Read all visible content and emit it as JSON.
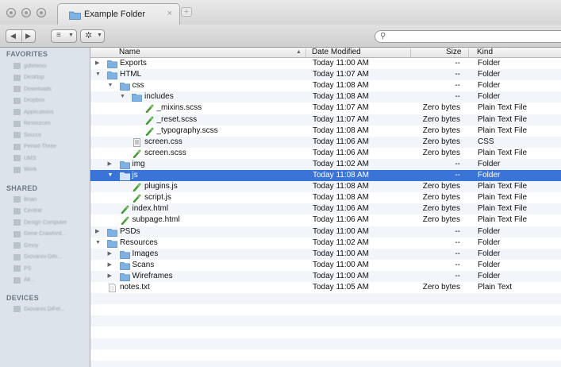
{
  "window": {
    "tab_title": "Example Folder",
    "tab_close": "×",
    "new_tab": "+",
    "search_placeholder": ""
  },
  "toolbar": {
    "back_icon": "back-arrow-icon",
    "forward_icon": "forward-arrow-icon",
    "view_icon": "list-view-icon",
    "action_icon": "gear-icon"
  },
  "sidebar": {
    "favorites_header": "FAVORITES",
    "favorites": [
      "gdfeterici",
      "Desktop",
      "Downloads",
      "Dropbox",
      "Applications",
      "Resources",
      "Source",
      "Period-Three",
      "UMS",
      "Work"
    ],
    "shared_header": "SHARED",
    "shared": [
      "Brian",
      "Central",
      "Design Computer",
      "Gene Crawford...",
      "Ginny",
      "Giovanni-Difo...",
      "PS",
      "All..."
    ],
    "devices_header": "DEVICES",
    "devices": [
      "Giovanni DiFel..."
    ]
  },
  "columns": {
    "name": "Name",
    "date": "Date Modified",
    "size": "Size",
    "kind": "Kind"
  },
  "colors": {
    "selection": "#3a74d6",
    "folder": "#7fb2e2",
    "sidebar": "#dde3ea",
    "scss_leaf": "#4a9d3a"
  },
  "rows": [
    {
      "name": "Exports",
      "date": "Today 11:00 AM",
      "size": "--",
      "kind": "Folder",
      "icon": "folder-icon",
      "indent": 0,
      "disclosure": "closed"
    },
    {
      "name": "HTML",
      "date": "Today 11:07 AM",
      "size": "--",
      "kind": "Folder",
      "icon": "folder-icon",
      "indent": 0,
      "disclosure": "open"
    },
    {
      "name": "css",
      "date": "Today 11:08 AM",
      "size": "--",
      "kind": "Folder",
      "icon": "folder-icon",
      "indent": 1,
      "disclosure": "open"
    },
    {
      "name": "includes",
      "date": "Today 11:08 AM",
      "size": "--",
      "kind": "Folder",
      "icon": "folder-icon",
      "indent": 2,
      "disclosure": "open"
    },
    {
      "name": "_mixins.scss",
      "date": "Today 11:07 AM",
      "size": "Zero bytes",
      "kind": "Plain Text File",
      "icon": "scss-file-icon",
      "indent": 3,
      "disclosure": "none"
    },
    {
      "name": "_reset.scss",
      "date": "Today 11:07 AM",
      "size": "Zero bytes",
      "kind": "Plain Text File",
      "icon": "scss-file-icon",
      "indent": 3,
      "disclosure": "none"
    },
    {
      "name": "_typography.scss",
      "date": "Today 11:08 AM",
      "size": "Zero bytes",
      "kind": "Plain Text File",
      "icon": "scss-file-icon",
      "indent": 3,
      "disclosure": "none"
    },
    {
      "name": "screen.css",
      "date": "Today 11:06 AM",
      "size": "Zero bytes",
      "kind": "CSS",
      "icon": "css-file-icon",
      "indent": 2,
      "disclosure": "none"
    },
    {
      "name": "screen.scss",
      "date": "Today 11:06 AM",
      "size": "Zero bytes",
      "kind": "Plain Text File",
      "icon": "scss-file-icon",
      "indent": 2,
      "disclosure": "none"
    },
    {
      "name": "img",
      "date": "Today 11:02 AM",
      "size": "--",
      "kind": "Folder",
      "icon": "folder-icon",
      "indent": 1,
      "disclosure": "closed"
    },
    {
      "name": "js",
      "date": "Today 11:08 AM",
      "size": "--",
      "kind": "Folder",
      "icon": "folder-icon",
      "indent": 1,
      "disclosure": "open",
      "selected": true
    },
    {
      "name": "plugins.js",
      "date": "Today 11:08 AM",
      "size": "Zero bytes",
      "kind": "Plain Text File",
      "icon": "js-file-icon",
      "indent": 2,
      "disclosure": "none"
    },
    {
      "name": "script.js",
      "date": "Today 11:08 AM",
      "size": "Zero bytes",
      "kind": "Plain Text File",
      "icon": "js-file-icon",
      "indent": 2,
      "disclosure": "none"
    },
    {
      "name": "index.html",
      "date": "Today 11:06 AM",
      "size": "Zero bytes",
      "kind": "Plain Text File",
      "icon": "html-file-icon",
      "indent": 1,
      "disclosure": "none"
    },
    {
      "name": "subpage.html",
      "date": "Today 11:06 AM",
      "size": "Zero bytes",
      "kind": "Plain Text File",
      "icon": "html-file-icon",
      "indent": 1,
      "disclosure": "none"
    },
    {
      "name": "PSDs",
      "date": "Today 11:00 AM",
      "size": "--",
      "kind": "Folder",
      "icon": "folder-icon",
      "indent": 0,
      "disclosure": "closed"
    },
    {
      "name": "Resources",
      "date": "Today 11:02 AM",
      "size": "--",
      "kind": "Folder",
      "icon": "folder-icon",
      "indent": 0,
      "disclosure": "open"
    },
    {
      "name": "Images",
      "date": "Today 11:00 AM",
      "size": "--",
      "kind": "Folder",
      "icon": "folder-icon",
      "indent": 1,
      "disclosure": "closed"
    },
    {
      "name": "Scans",
      "date": "Today 11:00 AM",
      "size": "--",
      "kind": "Folder",
      "icon": "folder-icon",
      "indent": 1,
      "disclosure": "closed"
    },
    {
      "name": "Wireframes",
      "date": "Today 11:00 AM",
      "size": "--",
      "kind": "Folder",
      "icon": "folder-icon",
      "indent": 1,
      "disclosure": "closed"
    },
    {
      "name": "notes.txt",
      "date": "Today 11:05 AM",
      "size": "Zero bytes",
      "kind": "Plain Text",
      "icon": "text-file-icon",
      "indent": 0,
      "disclosure": "none"
    }
  ]
}
